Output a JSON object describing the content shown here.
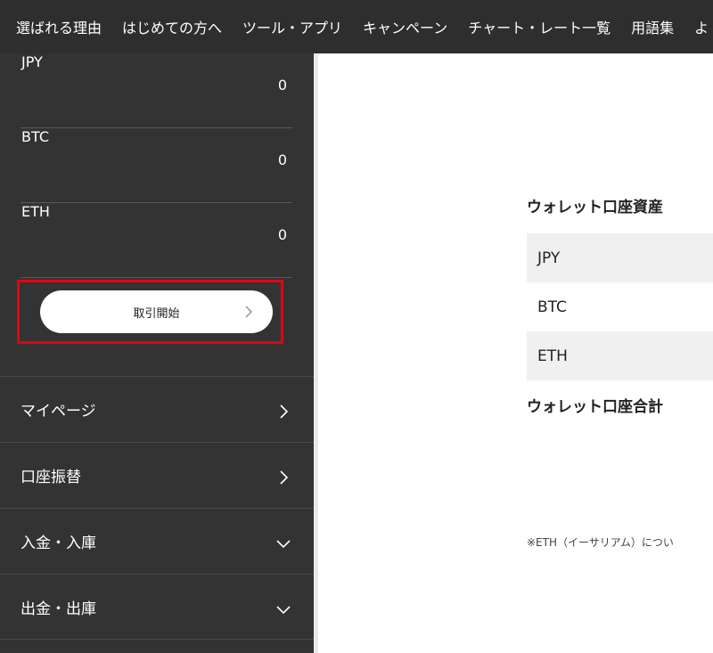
{
  "topnav": {
    "items": [
      "選ばれる理由",
      "はじめての方へ",
      "ツール・アプリ",
      "キャンペーン",
      "チャート・レート一覧",
      "用語集",
      "よ"
    ]
  },
  "sidebar": {
    "balances": [
      {
        "currency": "JPY",
        "amount": "0"
      },
      {
        "currency": "BTC",
        "amount": "0"
      },
      {
        "currency": "ETH",
        "amount": "0"
      }
    ],
    "start_button": "取引開始",
    "menu": [
      {
        "label": "マイページ",
        "icon": "chevron-right-icon"
      },
      {
        "label": "口座振替",
        "icon": "chevron-right-icon"
      },
      {
        "label": "入金・入庫",
        "icon": "chevron-down-icon"
      },
      {
        "label": "出金・出庫",
        "icon": "chevron-down-icon"
      }
    ]
  },
  "main": {
    "wallet_title": "ウォレット口座資産",
    "assets": [
      "JPY",
      "BTC",
      "ETH"
    ],
    "wallet_total": "ウォレット口座合計",
    "eth_note": "※ETH（イーサリアム）につい"
  },
  "colors": {
    "sidebar_bg": "#333333",
    "nav_bg": "#2e2e2e",
    "highlight": "#e60012"
  }
}
